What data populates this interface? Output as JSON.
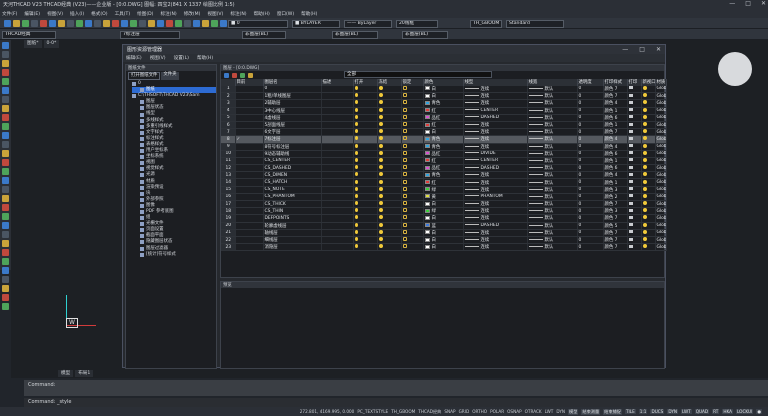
{
  "app": {
    "title": "天河THCAD V23 THCAD经典 (V23)——企业版 - [0:0.DWG] 图幅: 四宝2(841 X 1337 绘图比例 1:5)",
    "window_controls": [
      "—",
      "□",
      "✕"
    ]
  },
  "menubar": [
    "文件(F)",
    "编辑(E)",
    "视图(V)",
    "插入(I)",
    "格式(O)",
    "工具(T)",
    "绘图(D)",
    "标注(N)",
    "修改(M)",
    "视图(V)",
    "标注(N)",
    "帮助(H)",
    "窗口(W)",
    "帮助(H)"
  ],
  "toolbar2": {
    "layer_combo": "■ 0",
    "color_combo": "■ BYLAYER",
    "linetype_combo": "—— ByLayer",
    "lineweight_combo": "20线框",
    "textstyle_combo": "TH_GBOOM",
    "dimstyle_combo": "Standard"
  },
  "toolbar3": {
    "workspace_combo": "THCAD经典",
    "layer_combo2": "7标注层",
    "color2": "非图层(BL)",
    "linetype2": "非图层(BL)",
    "lineweight2": "非图层(BL)"
  },
  "drawing_tabs": [
    "图纸*",
    "0-0*"
  ],
  "model_tabs": [
    "模型",
    "布局1"
  ],
  "dialog": {
    "title": "图形资源管理器",
    "menu": [
      "编辑(E)",
      "视图(V)",
      "设置(L)",
      "帮助(H)"
    ],
    "left_title": "图纸文件",
    "left_tabs": [
      "打开图纸文件",
      "文件夹"
    ],
    "tree": [
      {
        "label": "0",
        "sel": false,
        "lvl": 0
      },
      {
        "label": "图纸",
        "sel": true,
        "lvl": 1
      },
      {
        "label": "C:\\THSOFT\\THCAD V23\\Sam",
        "sel": false,
        "lvl": 0
      },
      {
        "label": "图层",
        "sel": false,
        "lvl": 1
      },
      {
        "label": "图层状态",
        "sel": false,
        "lvl": 1
      },
      {
        "label": "线型",
        "sel": false,
        "lvl": 1
      },
      {
        "label": "多线样式",
        "sel": false,
        "lvl": 1
      },
      {
        "label": "多重引线样式",
        "sel": false,
        "lvl": 1
      },
      {
        "label": "文字样式",
        "sel": false,
        "lvl": 1
      },
      {
        "label": "标注样式",
        "sel": false,
        "lvl": 1
      },
      {
        "label": "表格样式",
        "sel": false,
        "lvl": 1
      },
      {
        "label": "用户坐标系",
        "sel": false,
        "lvl": 1
      },
      {
        "label": "坐标系统",
        "sel": false,
        "lvl": 1
      },
      {
        "label": "视图",
        "sel": false,
        "lvl": 1
      },
      {
        "label": "视觉样式",
        "sel": false,
        "lvl": 1
      },
      {
        "label": "光源",
        "sel": false,
        "lvl": 1
      },
      {
        "label": "材质",
        "sel": false,
        "lvl": 1
      },
      {
        "label": "渲染预设",
        "sel": false,
        "lvl": 1
      },
      {
        "label": "块",
        "sel": false,
        "lvl": 1
      },
      {
        "label": "外部参照",
        "sel": false,
        "lvl": 1
      },
      {
        "label": "图像",
        "sel": false,
        "lvl": 1
      },
      {
        "label": "PDF 参考底图",
        "sel": false,
        "lvl": 1
      },
      {
        "label": "组",
        "sel": false,
        "lvl": 1
      },
      {
        "label": "光栅文件",
        "sel": false,
        "lvl": 1
      },
      {
        "label": "页面设置",
        "sel": false,
        "lvl": 1
      },
      {
        "label": "截面平面",
        "sel": false,
        "lvl": 1
      },
      {
        "label": "隐藏图层状态",
        "sel": false,
        "lvl": 1
      },
      {
        "label": "图层过滤器",
        "sel": false,
        "lvl": 1
      },
      {
        "label": "[统计]符号样式",
        "sel": false,
        "lvl": 1
      }
    ],
    "right_title": "图层 - [0:0.DWG]",
    "filter_value": "全部",
    "columns": [
      "",
      "目前",
      "图层名",
      "描述",
      "打开",
      "冻结",
      "锁定",
      "颜色",
      "线型",
      "线宽",
      "透明度",
      "打印样式",
      "打印",
      "新视口",
      "材质"
    ],
    "rows": [
      [
        "1",
        "",
        "0",
        "",
        "white",
        "白",
        "连续",
        "默认",
        "0",
        "颜色 7"
      ],
      [
        "2",
        "",
        "1粗/单线图层",
        "",
        "white",
        "白",
        "连续",
        "默认",
        "0",
        "颜色 7"
      ],
      [
        "3",
        "",
        "2辅助层",
        "",
        "#2ea4e0",
        "青色",
        "连续",
        "默认",
        "0",
        "颜色 4"
      ],
      [
        "4",
        "",
        "3中心线层",
        "",
        "#e03b3b",
        "红",
        "CENTER",
        "默认",
        "0",
        "颜色 1"
      ],
      [
        "5",
        "",
        "4虚线层",
        "",
        "#d94fd1",
        "品红",
        "DASHED",
        "默认",
        "0",
        "颜色 6"
      ],
      [
        "6",
        "",
        "5剖面线层",
        "",
        "#e03b3b",
        "红",
        "连续",
        "默认",
        "0",
        "颜色 1"
      ],
      [
        "7",
        "",
        "6文字层",
        "",
        "white",
        "白",
        "连续",
        "默认",
        "0",
        "颜色 7"
      ],
      [
        "8",
        "✓",
        "7标注层",
        "",
        "#2ea4e0",
        "青色",
        "连续",
        "默认",
        "0",
        "颜色 4"
      ],
      [
        "9",
        "",
        "8符号标注层",
        "",
        "#2ea4e0",
        "青色",
        "连续",
        "默认",
        "0",
        "颜色 4"
      ],
      [
        "10",
        "",
        "9动态辅助线",
        "",
        "#d94fd1",
        "品红",
        "DIVIDE",
        "默认",
        "0",
        "颜色 6"
      ],
      [
        "11",
        "",
        "CS_CENTER",
        "",
        "#e03b3b",
        "红",
        "CENTER",
        "默认",
        "0",
        "颜色 1"
      ],
      [
        "12",
        "",
        "CS_DASHED",
        "",
        "#d94fd1",
        "品红",
        "DASHED",
        "默认",
        "0",
        "颜色 6"
      ],
      [
        "13",
        "",
        "CS_DIMEN",
        "",
        "#2ea4e0",
        "青色",
        "连续",
        "默认",
        "0",
        "颜色 4"
      ],
      [
        "14",
        "",
        "CS_HATCH",
        "",
        "#e03b3b",
        "红",
        "连续",
        "默认",
        "0",
        "颜色 1"
      ],
      [
        "15",
        "",
        "CS_NOTE",
        "",
        "#3bd13b",
        "绿",
        "连续",
        "默认",
        "0",
        "颜色 3"
      ],
      [
        "16",
        "",
        "CS_PHANTOM",
        "",
        "#e0e03b",
        "黄",
        "PHANTOM",
        "默认",
        "0",
        "颜色 2"
      ],
      [
        "17",
        "",
        "CS_THICK",
        "",
        "white",
        "白",
        "连续",
        "默认",
        "0",
        "颜色 7"
      ],
      [
        "18",
        "",
        "CS_THIN",
        "",
        "#3bd13b",
        "绿",
        "连续",
        "默认",
        "0",
        "颜色 3"
      ],
      [
        "19",
        "",
        "DEFPOINTS",
        "",
        "white",
        "白",
        "连续",
        "默认",
        "0",
        "颜色 7"
      ],
      [
        "20",
        "",
        "轮廓虚线层",
        "",
        "#3b7ae0",
        "蓝",
        "DASHED",
        "默认",
        "0",
        "颜色 5"
      ],
      [
        "21",
        "",
        "轴线层",
        "",
        "white",
        "白",
        "连续",
        "默认",
        "0",
        "颜色 7"
      ],
      [
        "22",
        "",
        "细线层",
        "",
        "white",
        "白",
        "连续",
        "默认",
        "0",
        "颜色 7"
      ],
      [
        "23",
        "",
        "消隐层",
        "",
        "white",
        "白",
        "连续",
        "默认",
        "0",
        "颜色 7"
      ]
    ],
    "material": "Global",
    "preview_title": "预览"
  },
  "command": {
    "history": "Command:",
    "current": "Command: _style"
  },
  "status": {
    "coords": "272.801, 4169.995, 0.000",
    "items": [
      "PC_TEXTSTYLE",
      "TH_GBOOM",
      "THCAD经典",
      "SNAP",
      "GRID",
      "ORTHO",
      "POLAR",
      "OSNAP",
      "OTRACK",
      "LWT",
      "DYN",
      "模型",
      "结束测量",
      "结束捕捉",
      "TILE",
      "1:1",
      "DUCS",
      "DYN",
      "LWT",
      "QUAD",
      "RT",
      "HKA",
      "LOCKUI",
      "●"
    ]
  },
  "colors": {
    "accent": "#2d6bd3",
    "bg": "#21252b"
  }
}
